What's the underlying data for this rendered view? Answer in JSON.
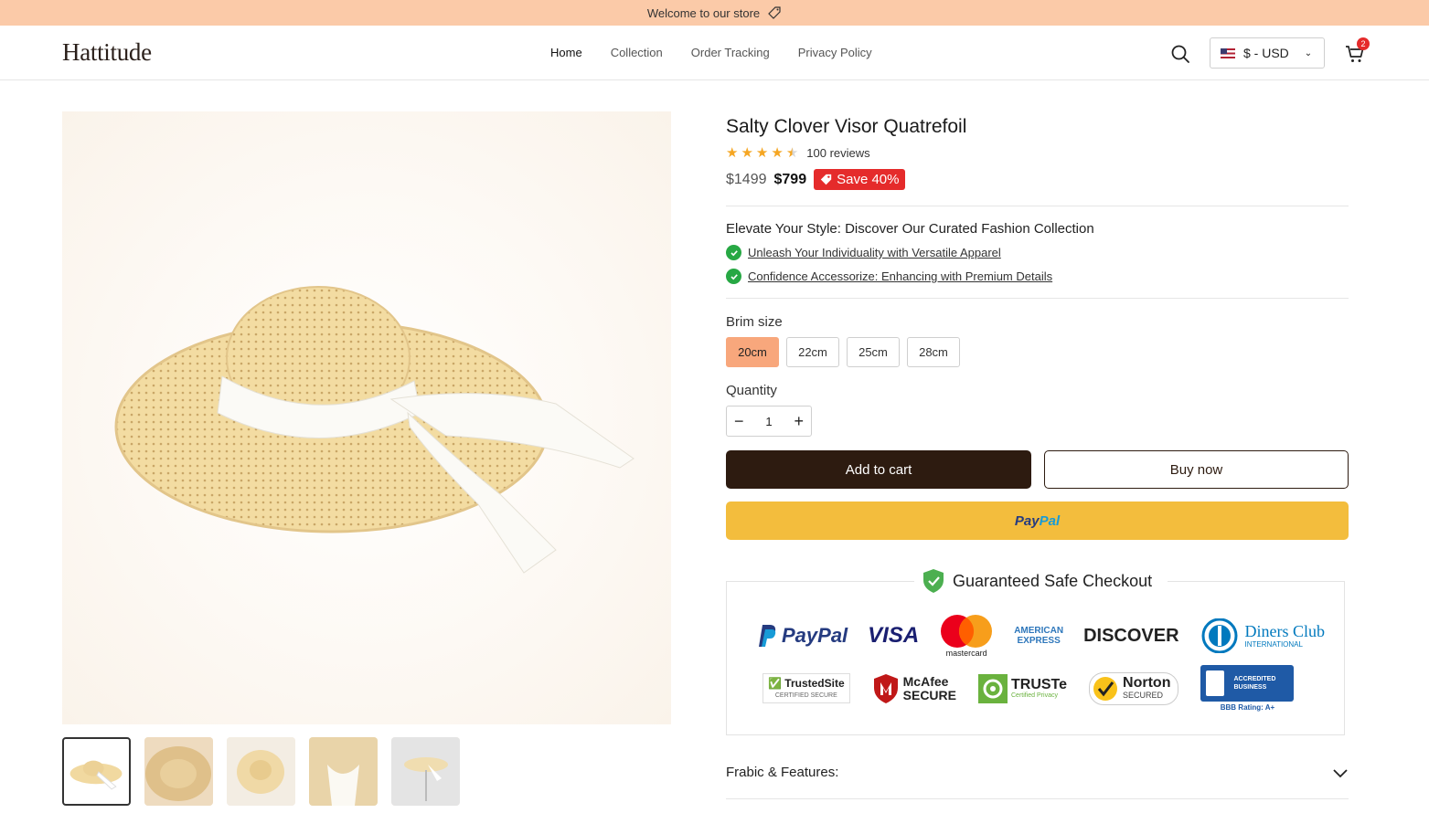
{
  "announcement": {
    "text": "Welcome to our store",
    "icon": "tag-icon"
  },
  "header": {
    "logo": "Hattitude",
    "nav": [
      "Home",
      "Collection",
      "Order Tracking",
      "Privacy Policy"
    ],
    "currency": "$ - USD",
    "cart_count": "2"
  },
  "product": {
    "title": "Salty Clover Visor Quatrefoil",
    "rating": 4.5,
    "reviews": "100 reviews",
    "price_old": "$1499",
    "price_new": "$799",
    "save_badge": "Save 40%",
    "features_title": "Elevate Your Style: Discover Our Curated Fashion Collection",
    "features": [
      "Unleash Your Individuality with Versatile Apparel",
      "Confidence Accessorize: Enhancing with Premium Details"
    ],
    "brim_label": "Brim size",
    "sizes": [
      "20cm",
      "22cm",
      "25cm",
      "28cm"
    ],
    "selected_size": "20cm",
    "quantity_label": "Quantity",
    "quantity": "1",
    "add_to_cart": "Add to cart",
    "buy_now": "Buy now",
    "paypal_a": "Pay",
    "paypal_b": "Pal"
  },
  "checkout": {
    "title": "Guaranteed Safe Checkout",
    "payment_logos": {
      "paypal": "PayPal",
      "visa": "VISA",
      "mastercard": "mastercard",
      "amex_1": "AMERICAN",
      "amex_2": "EXPRESS",
      "discover": "DISCOVER",
      "diners_1": "Diners Club",
      "diners_2": "INTERNATIONAL"
    },
    "trust_logos": {
      "trustedsite": "TrustedSite",
      "trustedsite_sub": "CERTIFIED SECURE",
      "mcafee_1": "McAfee",
      "mcafee_2": "SECURE",
      "truste": "TRUSTe",
      "truste_sub": "Certified Privacy",
      "norton_1": "Norton",
      "norton_2": "SECURED",
      "bbb_1": "ACCREDITED",
      "bbb_2": "BUSINESS",
      "bbb_3": "BBB Rating: A+"
    }
  },
  "accordion": {
    "label": "Frabic & Features:"
  },
  "colors": {
    "announcement_bg": "#fbcaa8",
    "accent": "#f8a77c",
    "save_red": "#e52b2b",
    "dark_button": "#2d1b10",
    "paypal_yellow": "#f3bd3d",
    "check_green": "#27a844"
  }
}
